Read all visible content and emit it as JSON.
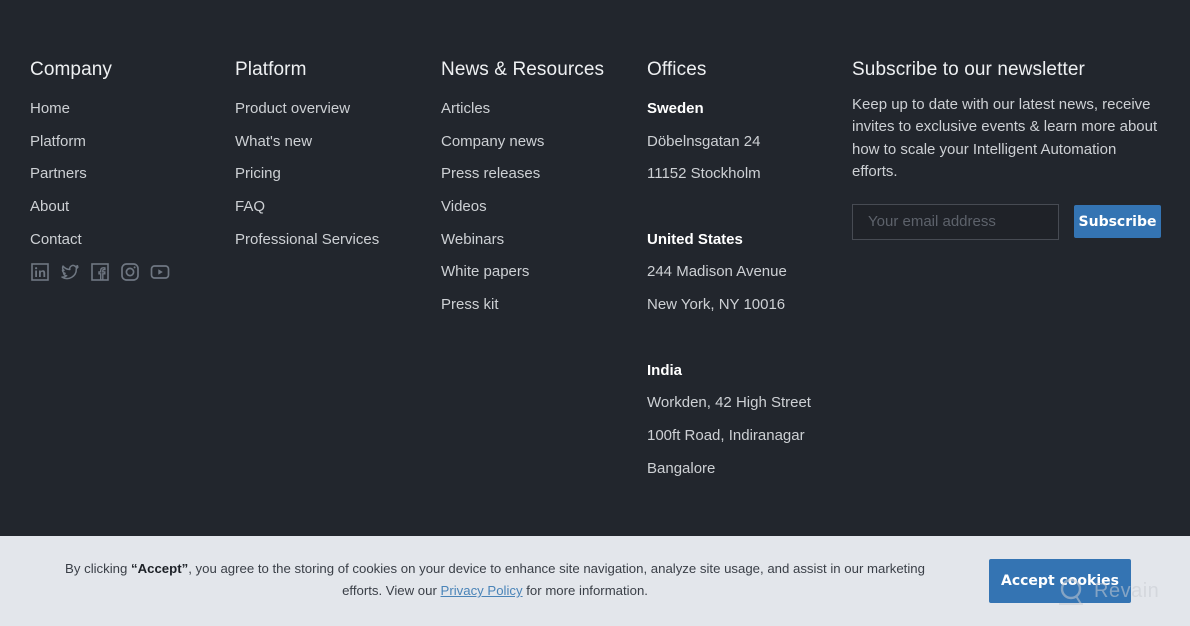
{
  "footer": {
    "company": {
      "heading": "Company",
      "links": [
        "Home",
        "Platform",
        "Partners",
        "About",
        "Contact"
      ],
      "social": [
        {
          "icon": "linkedin-icon"
        },
        {
          "icon": "twitter-icon"
        },
        {
          "icon": "facebook-icon"
        },
        {
          "icon": "instagram-icon"
        },
        {
          "icon": "youtube-icon"
        }
      ]
    },
    "platform": {
      "heading": "Platform",
      "links": [
        "Product overview",
        "What's new",
        "Pricing",
        "FAQ",
        "Professional Services"
      ]
    },
    "news": {
      "heading": "News & Resources",
      "links": [
        "Articles",
        "Company news",
        "Press releases",
        "Videos",
        "Webinars",
        "White papers",
        "Press kit"
      ]
    },
    "offices": {
      "heading": "Offices",
      "locations": [
        {
          "country": "Sweden",
          "lines": [
            "Döbelnsgatan 24",
            "11152 Stockholm"
          ]
        },
        {
          "country": "United States",
          "lines": [
            "244 Madison Avenue",
            "New York, NY 10016"
          ]
        },
        {
          "country": "India",
          "lines": [
            "Workden, 42 High Street",
            "100ft Road, Indiranagar",
            "Bangalore"
          ]
        }
      ]
    },
    "newsletter": {
      "heading": "Subscribe to our newsletter",
      "description": "Keep up to date with our latest news, receive invites to exclusive events & learn more about how to scale your Intelligent Automation efforts.",
      "email_placeholder": "Your email address",
      "email_value": "",
      "subscribe_label": "Subscribe"
    }
  },
  "cookie_banner": {
    "text_prefix": "By clicking ",
    "text_bold": "“Accept”",
    "text_middle": ", you agree to the storing of cookies on your device to enhance site navigation, analyze site usage, and assist in our marketing efforts. View our ",
    "privacy_link": "Privacy Policy",
    "text_suffix": " for more information.",
    "accept_label": "Accept cookies"
  },
  "watermark": {
    "text": "Revain"
  },
  "colors": {
    "footer_bg": "#22262d",
    "accent": "#3474b3",
    "cookie_bg": "#e3e6eb",
    "link": "#4a84b8"
  }
}
